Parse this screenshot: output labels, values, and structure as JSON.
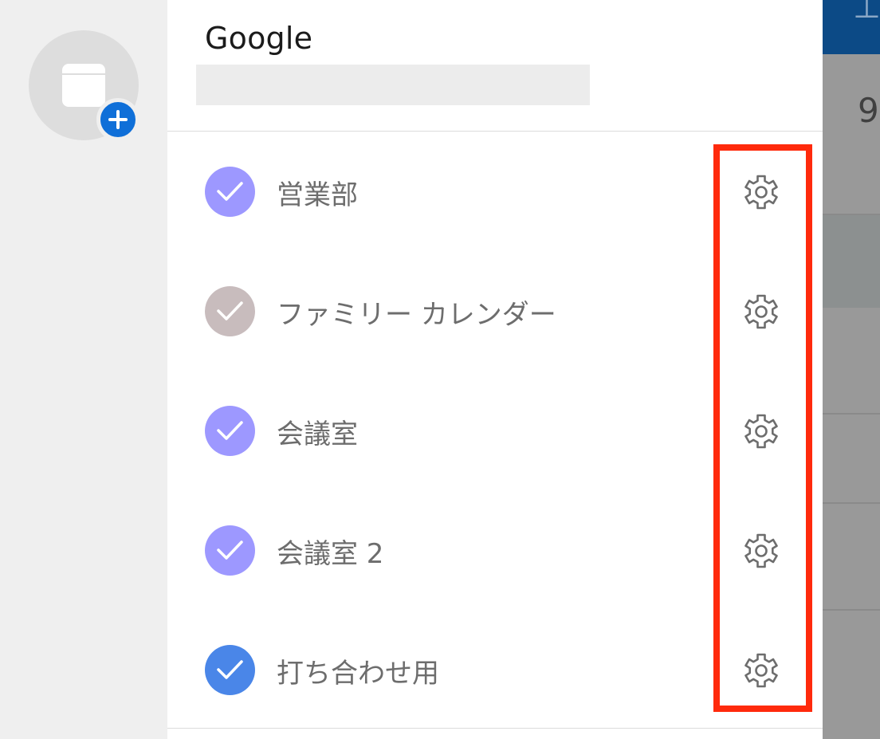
{
  "account": {
    "name": "Google"
  },
  "calendars": [
    {
      "label": "営業部",
      "color": "#9d98ff",
      "checked": true
    },
    {
      "label": "ファミリー カレンダー",
      "color": "#c8bcbd",
      "checked": true
    },
    {
      "label": "会議室",
      "color": "#9d98ff",
      "checked": true
    },
    {
      "label": "会議室 2",
      "color": "#9d98ff",
      "checked": true
    },
    {
      "label": "打ち合わせ用",
      "color": "#4a86e8",
      "checked": true
    }
  ],
  "icons": {
    "add_calendar": "calendar-add-icon",
    "row_check": "checkmark-icon",
    "row_settings": "gear-icon"
  },
  "background": {
    "visible_day": "9",
    "header_color": "#0c4a86"
  },
  "colors": {
    "highlight": "#ff2a0c",
    "plus_badge": "#0f6fd8"
  }
}
